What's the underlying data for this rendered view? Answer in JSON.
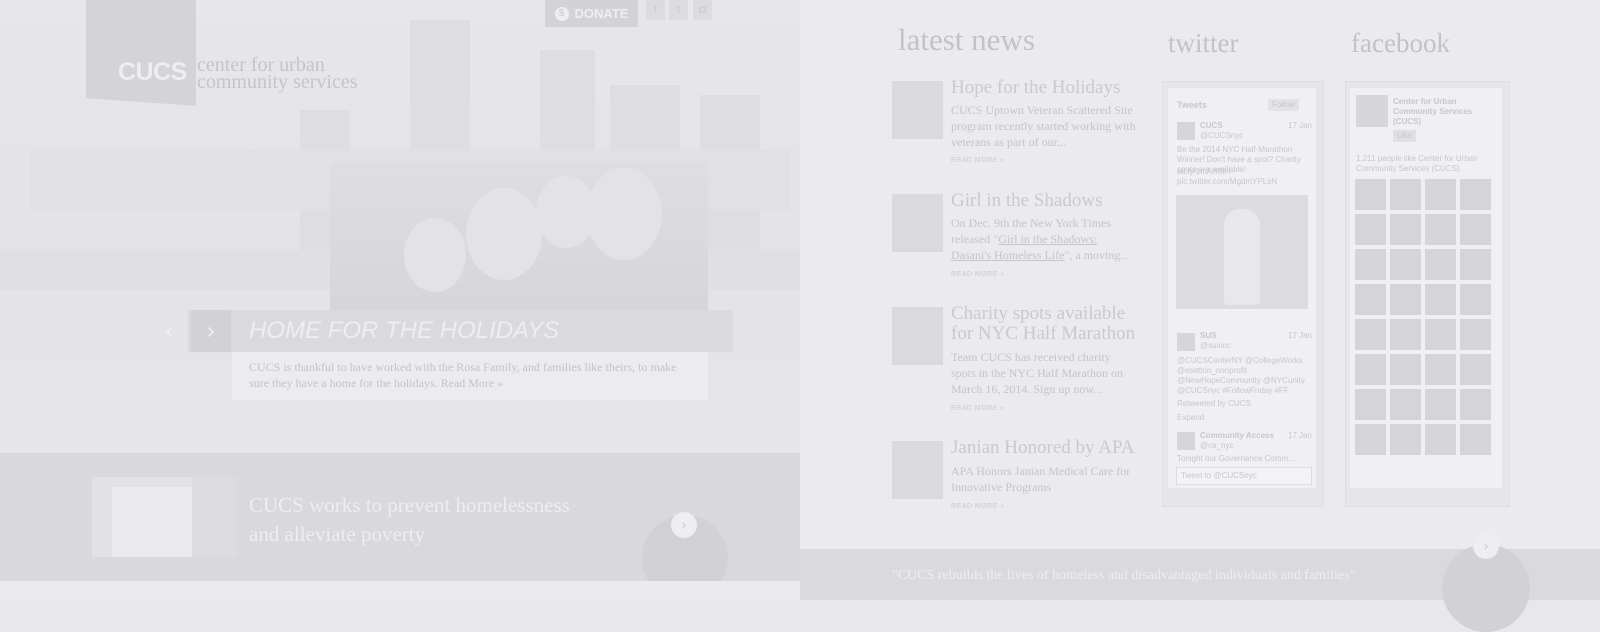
{
  "header": {
    "logo_text": "CUCS",
    "org_name_line1": "center for urban",
    "org_name_line2": "community services",
    "donate_label": "DONATE",
    "donate_icon": "$",
    "social": [
      {
        "name": "facebook",
        "glyph": "f"
      },
      {
        "name": "twitter",
        "glyph": "t"
      },
      {
        "name": "instagram",
        "glyph": "◘"
      }
    ]
  },
  "slider": {
    "title": "HOME FOR THE HOLIDAYS",
    "caption": "CUCS is thankful to have worked with the Rosa Family, and families like theirs, to make sure they have a home for the holidays.",
    "read_more": "Read More »",
    "prev_glyph": "‹",
    "next_glyph": "›"
  },
  "band": {
    "text_line1": "CUCS works to prevent homelessness",
    "text_line2": "and alleviate poverty",
    "next_glyph": "›"
  },
  "news": {
    "heading": "latest news",
    "read_more": "READ MORE »",
    "items": [
      {
        "title": "Hope for the Holidays",
        "excerpt": "CUCS Uptown Veteran Scattered Site program recently started working with veterans as part of our..."
      },
      {
        "title": "Girl in the Shadows",
        "excerpt_pre": "On Dec. 9th the New York Times released \"",
        "excerpt_link": "Girl in the Shadows: Dasani's Homeless Life",
        "excerpt_post": "\", a moving..."
      },
      {
        "title": "Charity spots available for NYC Half Marathon",
        "excerpt": "Team CUCS has received charity spots in the NYC Half Marathon on March 16, 2014. Sign up now..."
      },
      {
        "title": "Janian Honored by APA",
        "excerpt": "APA Honors Janian Medical Care for Innovative Programs"
      }
    ]
  },
  "twitter": {
    "heading": "twitter",
    "widget_title": "Tweets",
    "follow_label": "Follow",
    "tweet1_name": "CUCS",
    "tweet1_handle": "@CUCSnyc",
    "tweet1_date": "17 Jan",
    "tweet1_text": "Be the 2014 NYC Half-Marathon Winner! Don't have a spot? Charity spots are available!",
    "tweet1_link": "bit.ly/1mAH3fH",
    "tweet1_pic": "pic.twitter.com/MgdmYPLsN",
    "tweet2_name": "SUS",
    "tweet2_handle": "@susinc",
    "tweet2_date": "17 Jan",
    "tweet2_text": "@CUCSCenterNY @CollegeWorks @esetton_nonprofit @NewHopeCommunity @NYCunity @CUCSnyc #FollowFriday #FF",
    "tweet2_retweet": "Retweeted by CUCS",
    "tweet2_expand": "Expand",
    "tweet3_name": "Community Access",
    "tweet3_handle": "@ca_nyc",
    "tweet3_date": "17 Jan",
    "tweet3_text": "Tonight our Governance Comm...",
    "compose_placeholder": "Tweet to @CUCSnyc"
  },
  "facebook": {
    "heading": "facebook",
    "page_name": "Center for Urban Community Services (CUCS)",
    "like_label": "Like",
    "likes_text": "1,211 people like Center for Urban Community Services (CUCS)."
  },
  "footer": {
    "quote": "\"CUCS rebuilds the lives of homeless and disadvantaged individuals and families\"",
    "next_glyph": "›"
  },
  "colors": {
    "accent": "#d3d3d8",
    "background": "#e8e8eb"
  }
}
